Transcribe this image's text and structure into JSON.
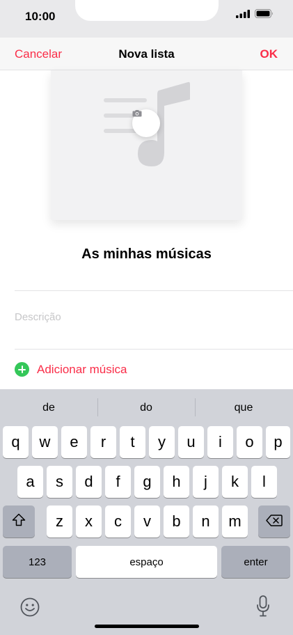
{
  "status": {
    "time": "10:00"
  },
  "nav": {
    "cancel": "Cancelar",
    "title": "Nova lista",
    "ok": "OK"
  },
  "playlist": {
    "title": "As minhas músicas",
    "description_placeholder": "Descrição",
    "add_music": "Adicionar música"
  },
  "keyboard": {
    "suggestions": [
      "de",
      "do",
      "que"
    ],
    "row1": [
      "q",
      "w",
      "e",
      "r",
      "t",
      "y",
      "u",
      "i",
      "o",
      "p"
    ],
    "row2": [
      "a",
      "s",
      "d",
      "f",
      "g",
      "h",
      "j",
      "k",
      "l"
    ],
    "row3": [
      "z",
      "x",
      "c",
      "v",
      "b",
      "n",
      "m"
    ],
    "numbers_key": "123",
    "space_key": "espaço",
    "enter_key": "enter"
  },
  "colors": {
    "accent": "#fa2d48",
    "add_green": "#34c759",
    "keyboard_bg": "#d1d3d9"
  },
  "icons": [
    "signal-icon",
    "battery-icon",
    "camera-icon",
    "music-note-icon",
    "shift-icon",
    "backspace-icon",
    "emoji-icon",
    "microphone-icon"
  ]
}
